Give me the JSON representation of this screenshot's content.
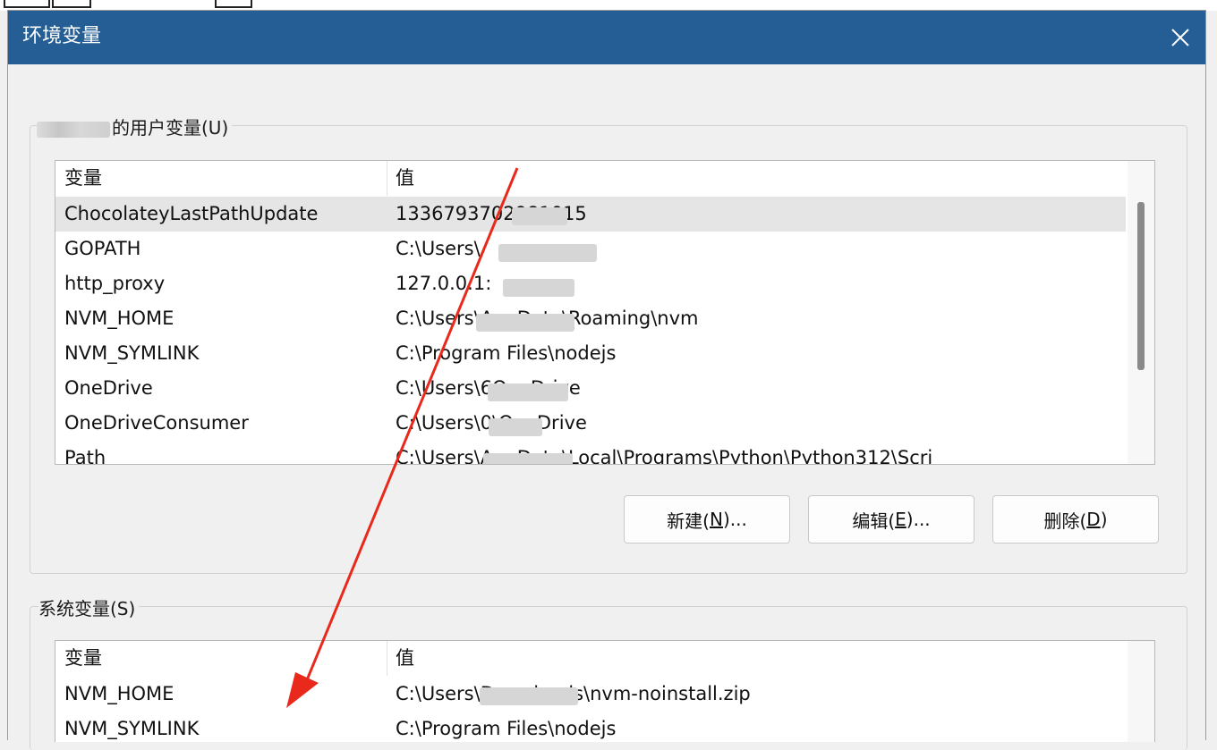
{
  "window": {
    "title": "环境变量",
    "close_icon": "close-icon"
  },
  "user_vars": {
    "group_label": "的用户变量(U)",
    "columns": {
      "name": "变量",
      "value": "值"
    },
    "rows": [
      {
        "name": "ChocolateyLastPathUpdate",
        "value": "1336793702981015"
      },
      {
        "name": "GOPATH",
        "value": "C:\\Users\\"
      },
      {
        "name": "http_proxy",
        "value": "127.0.0.1:"
      },
      {
        "name": "NVM_HOME",
        "value": "C:\\Users\\AppData\\Roaming\\nvm"
      },
      {
        "name": "NVM_SYMLINK",
        "value": "C:\\Program Files\\nodejs"
      },
      {
        "name": "OneDrive",
        "value": "C:\\Users\\6OneDrive"
      },
      {
        "name": "OneDriveConsumer",
        "value": "C:\\Users\\0\\OneDrive"
      },
      {
        "name": "Path",
        "value": "C:\\Users\\AppData\\Local\\Programs\\Python\\Python312\\Scri"
      }
    ],
    "buttons": {
      "new": {
        "pre": "新建(",
        "key": "N",
        "post": ")..."
      },
      "edit": {
        "pre": "编辑(",
        "key": "E",
        "post": ")..."
      },
      "delete": {
        "pre": "删除(",
        "key": "D",
        "post": ")"
      }
    }
  },
  "system_vars": {
    "group_label": "系统变量(S)",
    "columns": {
      "name": "变量",
      "value": "值"
    },
    "rows": [
      {
        "name": "NVM_HOME",
        "value": "C:\\Users\\Downloads\\nvm-noinstall.zip"
      },
      {
        "name": "NVM_SYMLINK",
        "value": "C:\\Program Files\\nodejs"
      }
    ]
  },
  "annotation": {
    "arrow_color": "#e8291c"
  },
  "colors": {
    "titlebar": "#245e94",
    "selected_row": "#e5e5e5"
  }
}
